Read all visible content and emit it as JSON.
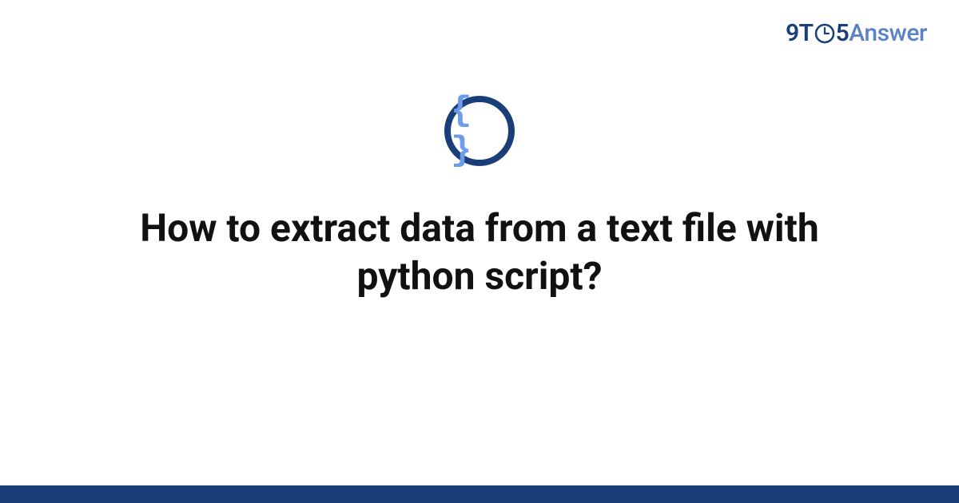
{
  "header": {
    "brand_part1": "9T",
    "brand_part2": "5",
    "brand_part3": "Answer"
  },
  "icon": {
    "name": "code-braces-icon",
    "glyph": "{ }"
  },
  "main": {
    "title": "How to extract data from a text file with python script?"
  },
  "colors": {
    "brand_dark": "#1a3e7a",
    "brand_light": "#5b82c7",
    "icon_braces": "#6b9de8",
    "text": "#111111",
    "background": "#ffffff"
  }
}
